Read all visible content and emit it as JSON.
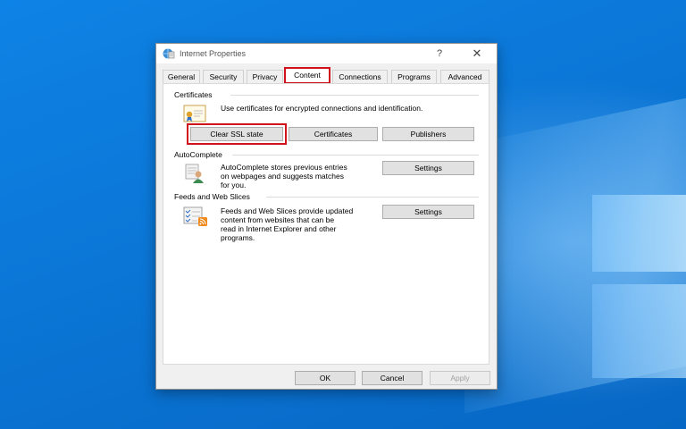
{
  "window": {
    "title": "Internet Properties",
    "help_glyph": "?",
    "close_glyph": "✕"
  },
  "tabs": [
    {
      "label": "General"
    },
    {
      "label": "Security"
    },
    {
      "label": "Privacy"
    },
    {
      "label": "Content"
    },
    {
      "label": "Connections"
    },
    {
      "label": "Programs"
    },
    {
      "label": "Advanced"
    }
  ],
  "active_tab": "Content",
  "certificates": {
    "group_label": "Certificates",
    "description": "Use certificates for encrypted connections and identification.",
    "icon": "certificate-icon",
    "buttons": {
      "clear_ssl": "Clear SSL state",
      "certificates": "Certificates",
      "publishers": "Publishers"
    }
  },
  "autocomplete": {
    "group_label": "AutoComplete",
    "description_lines": [
      "AutoComplete stores previous entries",
      "on webpages and suggests matches",
      "for you."
    ],
    "icon": "autocomplete-user-icon",
    "settings_label": "Settings"
  },
  "feeds": {
    "group_label": "Feeds and Web Slices",
    "description_lines": [
      "Feeds and Web Slices provide updated",
      "content from websites that can be",
      "read in Internet Explorer and other",
      "programs."
    ],
    "icon": "rss-feed-icon",
    "settings_label": "Settings"
  },
  "footer": {
    "ok": "OK",
    "cancel": "Cancel",
    "apply": "Apply"
  },
  "colors": {
    "highlight": "#d0121b",
    "desktop": "#0a78d7"
  }
}
